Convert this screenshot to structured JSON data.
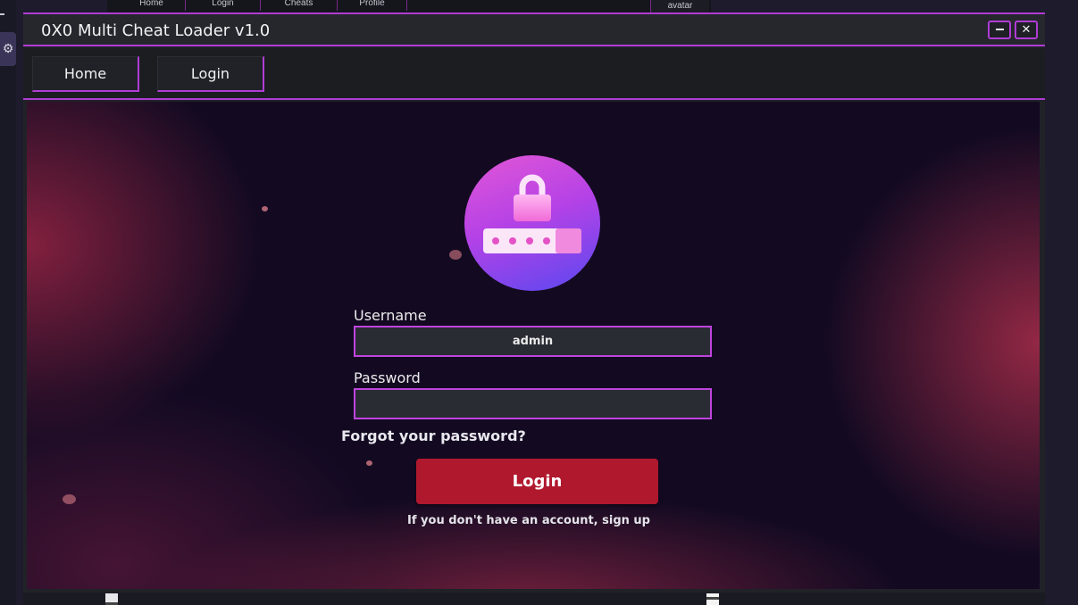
{
  "background_window": {
    "tabs": [
      "Home",
      "Login",
      "Cheats",
      "Profile"
    ],
    "avatar_label": "avatar"
  },
  "window": {
    "title": "0X0 Multi Cheat Loader v1.0",
    "minimize_icon": "minimize-icon",
    "close_symbol": "✕"
  },
  "nav": {
    "home_label": "Home",
    "login_label": "Login"
  },
  "login_form": {
    "username_label": "Username",
    "username_value": "admin",
    "password_label": "Password",
    "password_value": "",
    "forgot_link": "Forgot your password?",
    "login_button": "Login",
    "signup_text": "If you don't have an account, sign up"
  },
  "colors": {
    "accent": "#b13cd6",
    "login_button": "#b0182e",
    "content_bg": "#130a22"
  }
}
